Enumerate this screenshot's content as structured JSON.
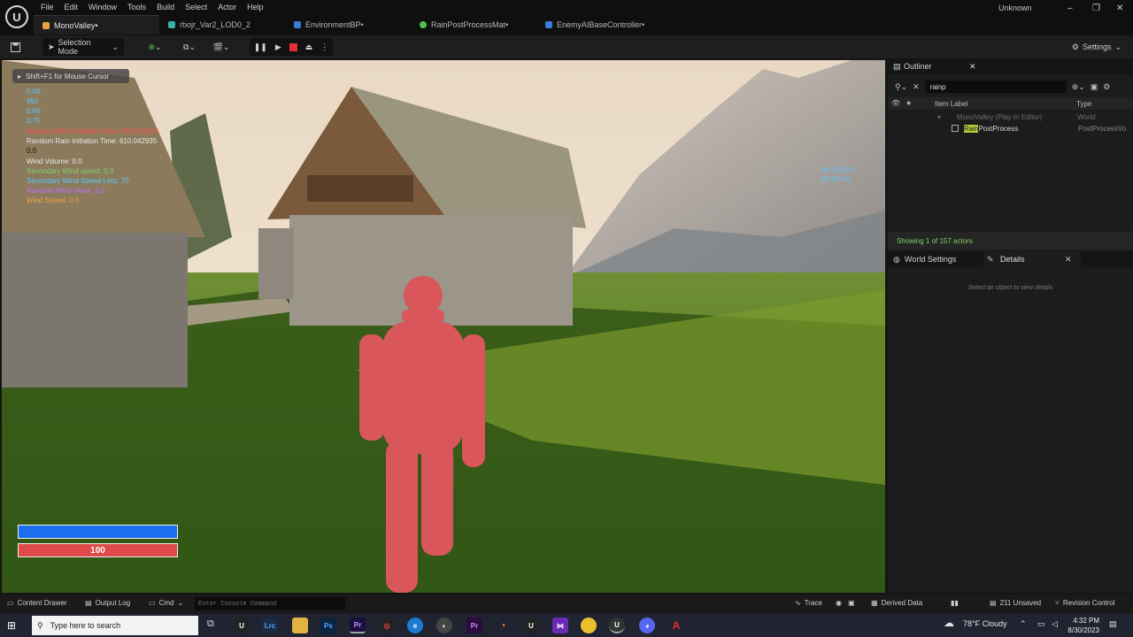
{
  "menu": [
    "File",
    "Edit",
    "Window",
    "Tools",
    "Build",
    "Select",
    "Actor",
    "Help"
  ],
  "tabs": [
    {
      "label": "MonoValley•",
      "color": "#e9a640"
    },
    {
      "label": "rbojr_Var2_LOD0_2",
      "color": "#39b5a8"
    },
    {
      "label": "EnvironmentBP•",
      "color": "#3a7bdc"
    },
    {
      "label": "RainPostProcessMat•",
      "color": "#4ec34e"
    },
    {
      "label": "EnemyAIBaseController•",
      "color": "#3a7bdc"
    }
  ],
  "user": "Unknown",
  "toolbar": {
    "selection_mode": "Selection Mode",
    "settings": "Settings"
  },
  "viewport": {
    "hint": "Shift+F1 for Mouse Cursor",
    "debug_lines": [
      {
        "text": "0.00",
        "color": "#58c8ff"
      },
      {
        "text": "950",
        "color": "#58c8ff"
      },
      {
        "text": "0.00",
        "color": "#58c8ff"
      },
      {
        "text": "0.75",
        "color": "#58c8ff"
      },
      {
        "text": "Random Wind Initiation Time: 455.524263",
        "color": "#ff4b4b"
      },
      {
        "text": "Random Rain Initiation Time: 610.042935",
        "color": "#e9e9e9"
      },
      {
        "text": "0.0",
        "color": "#111111"
      },
      {
        "text": "Wind Volume: 0.0",
        "color": "#e9e9e9"
      },
      {
        "text": "Secondary Wind speed: 0.0",
        "color": "#7ed36a"
      },
      {
        "text": "Secondary Wind Speed Lerp: 70",
        "color": "#58c8ff"
      },
      {
        "text": "Random Wind Value: 0.0",
        "color": "#c46cff"
      },
      {
        "text": "Wind Speed: 0.0",
        "color": "#e9a640"
      }
    ],
    "fps": "48.23 FPS",
    "ms": "20.60 ms",
    "health": "100"
  },
  "outliner": {
    "title": "Outliner",
    "search_value": "rainp",
    "col_label": "Item Label",
    "col_type": "Type",
    "rows": [
      {
        "label": "MonoValley (Play In Editor)",
        "type": "World"
      },
      {
        "label_highlight": "Rain",
        "label_rest": "PostProcess",
        "type": "PostProcessVo"
      }
    ],
    "showing": "Showing 1 of 157 actors"
  },
  "details": {
    "tab_world": "World Settings",
    "tab_details": "Details",
    "empty": "Select an object to view details"
  },
  "statusbar": {
    "content_drawer": "Content Drawer",
    "output_log": "Output Log",
    "cmd": "Cmd",
    "console_placeholder": "Enter Console Command",
    "trace": "Trace",
    "derived": "Derived Data",
    "unsaved": "211 Unsaved",
    "revision": "Revision Control"
  },
  "taskbar": {
    "search": "Type here to search",
    "weather": "78°F  Cloudy",
    "time": "4:32 PM",
    "date": "8/30/2023"
  }
}
